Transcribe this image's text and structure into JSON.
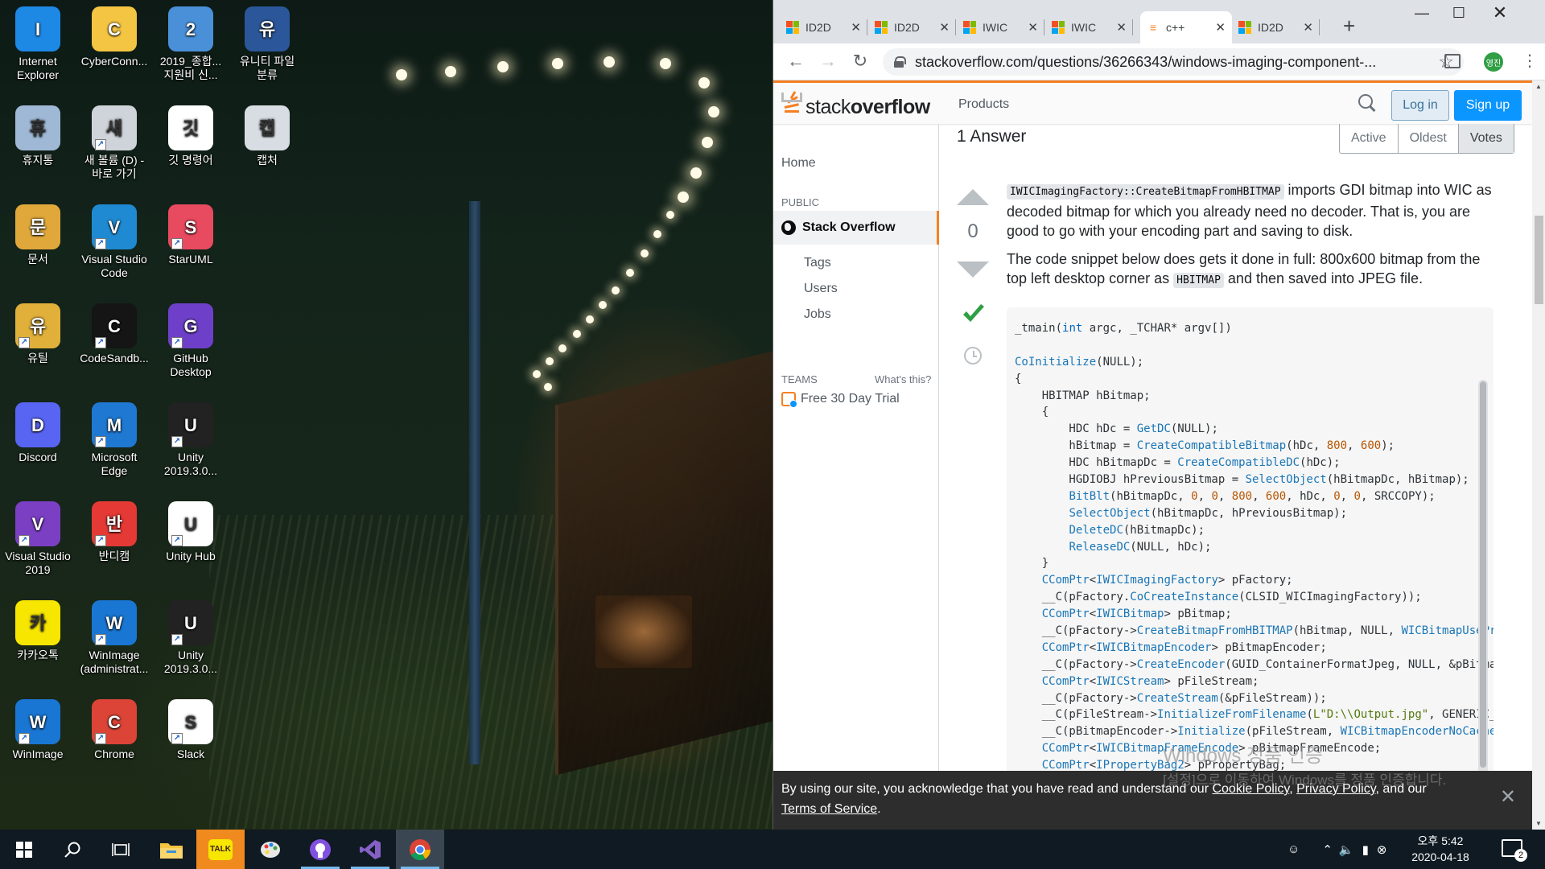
{
  "desktop": {
    "icons": [
      {
        "label": "Internet\nExplorer",
        "icon": "internet-explorer-icon",
        "color": "#1e88e5"
      },
      {
        "label": "CyberConn...",
        "icon": "folder-icon",
        "color": "#f4c542"
      },
      {
        "label": "2019_종합...\n지원비 신...",
        "icon": "document-icon",
        "color": "#4a90d9"
      },
      {
        "label": "유니티 파일\n분류",
        "icon": "word-document-icon",
        "color": "#2b579a"
      },
      {
        "label": "휴지통",
        "icon": "recycle-bin-icon",
        "color": "#9fb8d6"
      },
      {
        "label": "새 볼륨 (D) -\n바로 가기",
        "icon": "drive-icon",
        "color": "#cfd4da"
      },
      {
        "label": "깃 명령어",
        "icon": "text-file-icon",
        "color": "#ffffff"
      },
      {
        "label": "캡처",
        "icon": "image-file-icon",
        "color": "#d8dde3"
      },
      {
        "label": "문서",
        "icon": "documents-folder-icon",
        "color": "#e0a83a"
      },
      {
        "label": "Visual Studio\nCode",
        "icon": "vscode-icon",
        "color": "#1f8ad2"
      },
      {
        "label": "StarUML",
        "icon": "staruml-icon",
        "color": "#e84a5f"
      },
      {
        "label": "유틸",
        "icon": "utility-folder-icon",
        "color": "#e0b03a"
      },
      {
        "label": "CodeSandb...",
        "icon": "codesandbox-icon",
        "color": "#151515"
      },
      {
        "label": "GitHub\nDesktop",
        "icon": "github-desktop-icon",
        "color": "#6e40c9"
      },
      {
        "label": "Discord",
        "icon": "discord-icon",
        "color": "#5865f2"
      },
      {
        "label": "Microsoft\nEdge",
        "icon": "edge-icon",
        "color": "#1f78d1"
      },
      {
        "label": "Unity\n2019.3.0...",
        "icon": "unity-icon",
        "color": "#222222"
      },
      {
        "label": "Visual Studio\n2019",
        "icon": "visual-studio-icon",
        "color": "#7b3fc4"
      },
      {
        "label": "반디캠",
        "icon": "bandicam-icon",
        "color": "#e53935"
      },
      {
        "label": "Unity Hub",
        "icon": "unity-hub-icon",
        "color": "#ffffff"
      },
      {
        "label": "카카오톡",
        "icon": "kakaotalk-icon",
        "color": "#f7e600"
      },
      {
        "label": "WinImage\n(administrat...",
        "icon": "winimage-icon",
        "color": "#1976d2"
      },
      {
        "label": "Unity\n2019.3.0...",
        "icon": "unity-icon",
        "color": "#222222"
      },
      {
        "label": "WinImage",
        "icon": "winimage-icon",
        "color": "#1976d2"
      },
      {
        "label": "Chrome",
        "icon": "chrome-icon",
        "color": "#db4437"
      },
      {
        "label": "Slack",
        "icon": "slack-icon",
        "color": "#ffffff"
      }
    ]
  },
  "browser": {
    "tabs": [
      {
        "title": "ID2D",
        "favicon": "windows-favicon"
      },
      {
        "title": "ID2D",
        "favicon": "windows-favicon"
      },
      {
        "title": "IWIC",
        "favicon": "windows-favicon"
      },
      {
        "title": "IWIC",
        "favicon": "windows-favicon"
      },
      {
        "title": "c++",
        "favicon": "stackoverflow-favicon",
        "active": true
      },
      {
        "title": "ID2D",
        "favicon": "windows-favicon"
      }
    ],
    "url": "stackoverflow.com/questions/36266343/windows-imaging-component-...",
    "profile_label": "영진"
  },
  "so": {
    "logo_light": "stack",
    "logo_bold": "overflow",
    "products": "Products",
    "login": "Log in",
    "signup": "Sign up",
    "nav": {
      "home": "Home",
      "public": "PUBLIC",
      "stack_overflow": "Stack Overflow",
      "tags": "Tags",
      "users": "Users",
      "jobs": "Jobs",
      "teams": "TEAMS",
      "whats_this": "What's this?",
      "free_trial": "Free 30 Day Trial"
    },
    "answers_header": "1 Answer",
    "sort_tabs": [
      "Active",
      "Oldest",
      "Votes"
    ],
    "vote_count": "0",
    "post": {
      "p1_code": "IWICImagingFactory::CreateBitmapFromHBITMAP",
      "p1_text": " imports GDI bitmap into WIC as decoded bitmap for which you already need no decoder. That is, you are good to go with your encoding part and saving to disk.",
      "p2_text1": "The code snippet below does gets it done in full: 800x600 bitmap from the top left desktop corner as ",
      "p2_code": "HBITMAP",
      "p2_text2": " and then saved into JPEG file."
    },
    "code_lines": [
      "_tmain(int argc, _TCHAR* argv[])",
      "",
      "CoInitialize(NULL);",
      "{",
      "    HBITMAP hBitmap;",
      "    {",
      "        HDC hDc = GetDC(NULL);",
      "        hBitmap = CreateCompatibleBitmap(hDc, 800, 600);",
      "        HDC hBitmapDc = CreateCompatibleDC(hDc);",
      "        HGDIOBJ hPreviousBitmap = SelectObject(hBitmapDc, hBitmap);",
      "        BitBlt(hBitmapDc, 0, 0, 800, 600, hDc, 0, 0, SRCCOPY);",
      "        SelectObject(hBitmapDc, hPreviousBitmap);",
      "        DeleteDC(hBitmapDc);",
      "        ReleaseDC(NULL, hDc);",
      "    }",
      "    CComPtr<IWICImagingFactory> pFactory;",
      "    __C(pFactory.CoCreateInstance(CLSID_WICImagingFactory));",
      "    CComPtr<IWICBitmap> pBitmap;",
      "    __C(pFactory->CreateBitmapFromHBITMAP(hBitmap, NULL, WICBitmapUsePremultipliedAlpha, &pBitmap));",
      "    CComPtr<IWICBitmapEncoder> pBitmapEncoder;",
      "    __C(pFactory->CreateEncoder(GUID_ContainerFormatJpeg, NULL, &pBitmapEncoder));",
      "    CComPtr<IWICStream> pFileStream;",
      "    __C(pFactory->CreateStream(&pFileStream));",
      "    __C(pFileStream->InitializeFromFilename(L\"D:\\\\Output.jpg\", GENERIC_WRITE));",
      "    __C(pBitmapEncoder->Initialize(pFileStream, WICBitmapEncoderNoCache));",
      "    CComPtr<IWICBitmapFrameEncode> pBitmapFrameEncode;",
      "    CComPtr<IPropertyBag2> pPropertyBag;"
    ],
    "cookie": {
      "text": "By using our site, you acknowledge that you have read and understand our ",
      "cookie_policy": "Cookie Policy",
      "sep": ", ",
      "privacy_policy": "Privacy Policy",
      "and_our": ", and our ",
      "terms": "Terms of Service",
      "end": "."
    }
  },
  "watermark": {
    "line1": "Windows 정품 인증",
    "line2": "[설정]으로 이동하여 Windows를 정품 인증합니다."
  },
  "taskbar": {
    "clock_time": "오후 5:42",
    "clock_date": "2020-04-18",
    "notif_count": "2",
    "kakao_label": "TALK"
  },
  "colors": {
    "so_orange": "#f48024",
    "so_blue": "#0a95ff",
    "accepted_green": "#2f6f44"
  }
}
